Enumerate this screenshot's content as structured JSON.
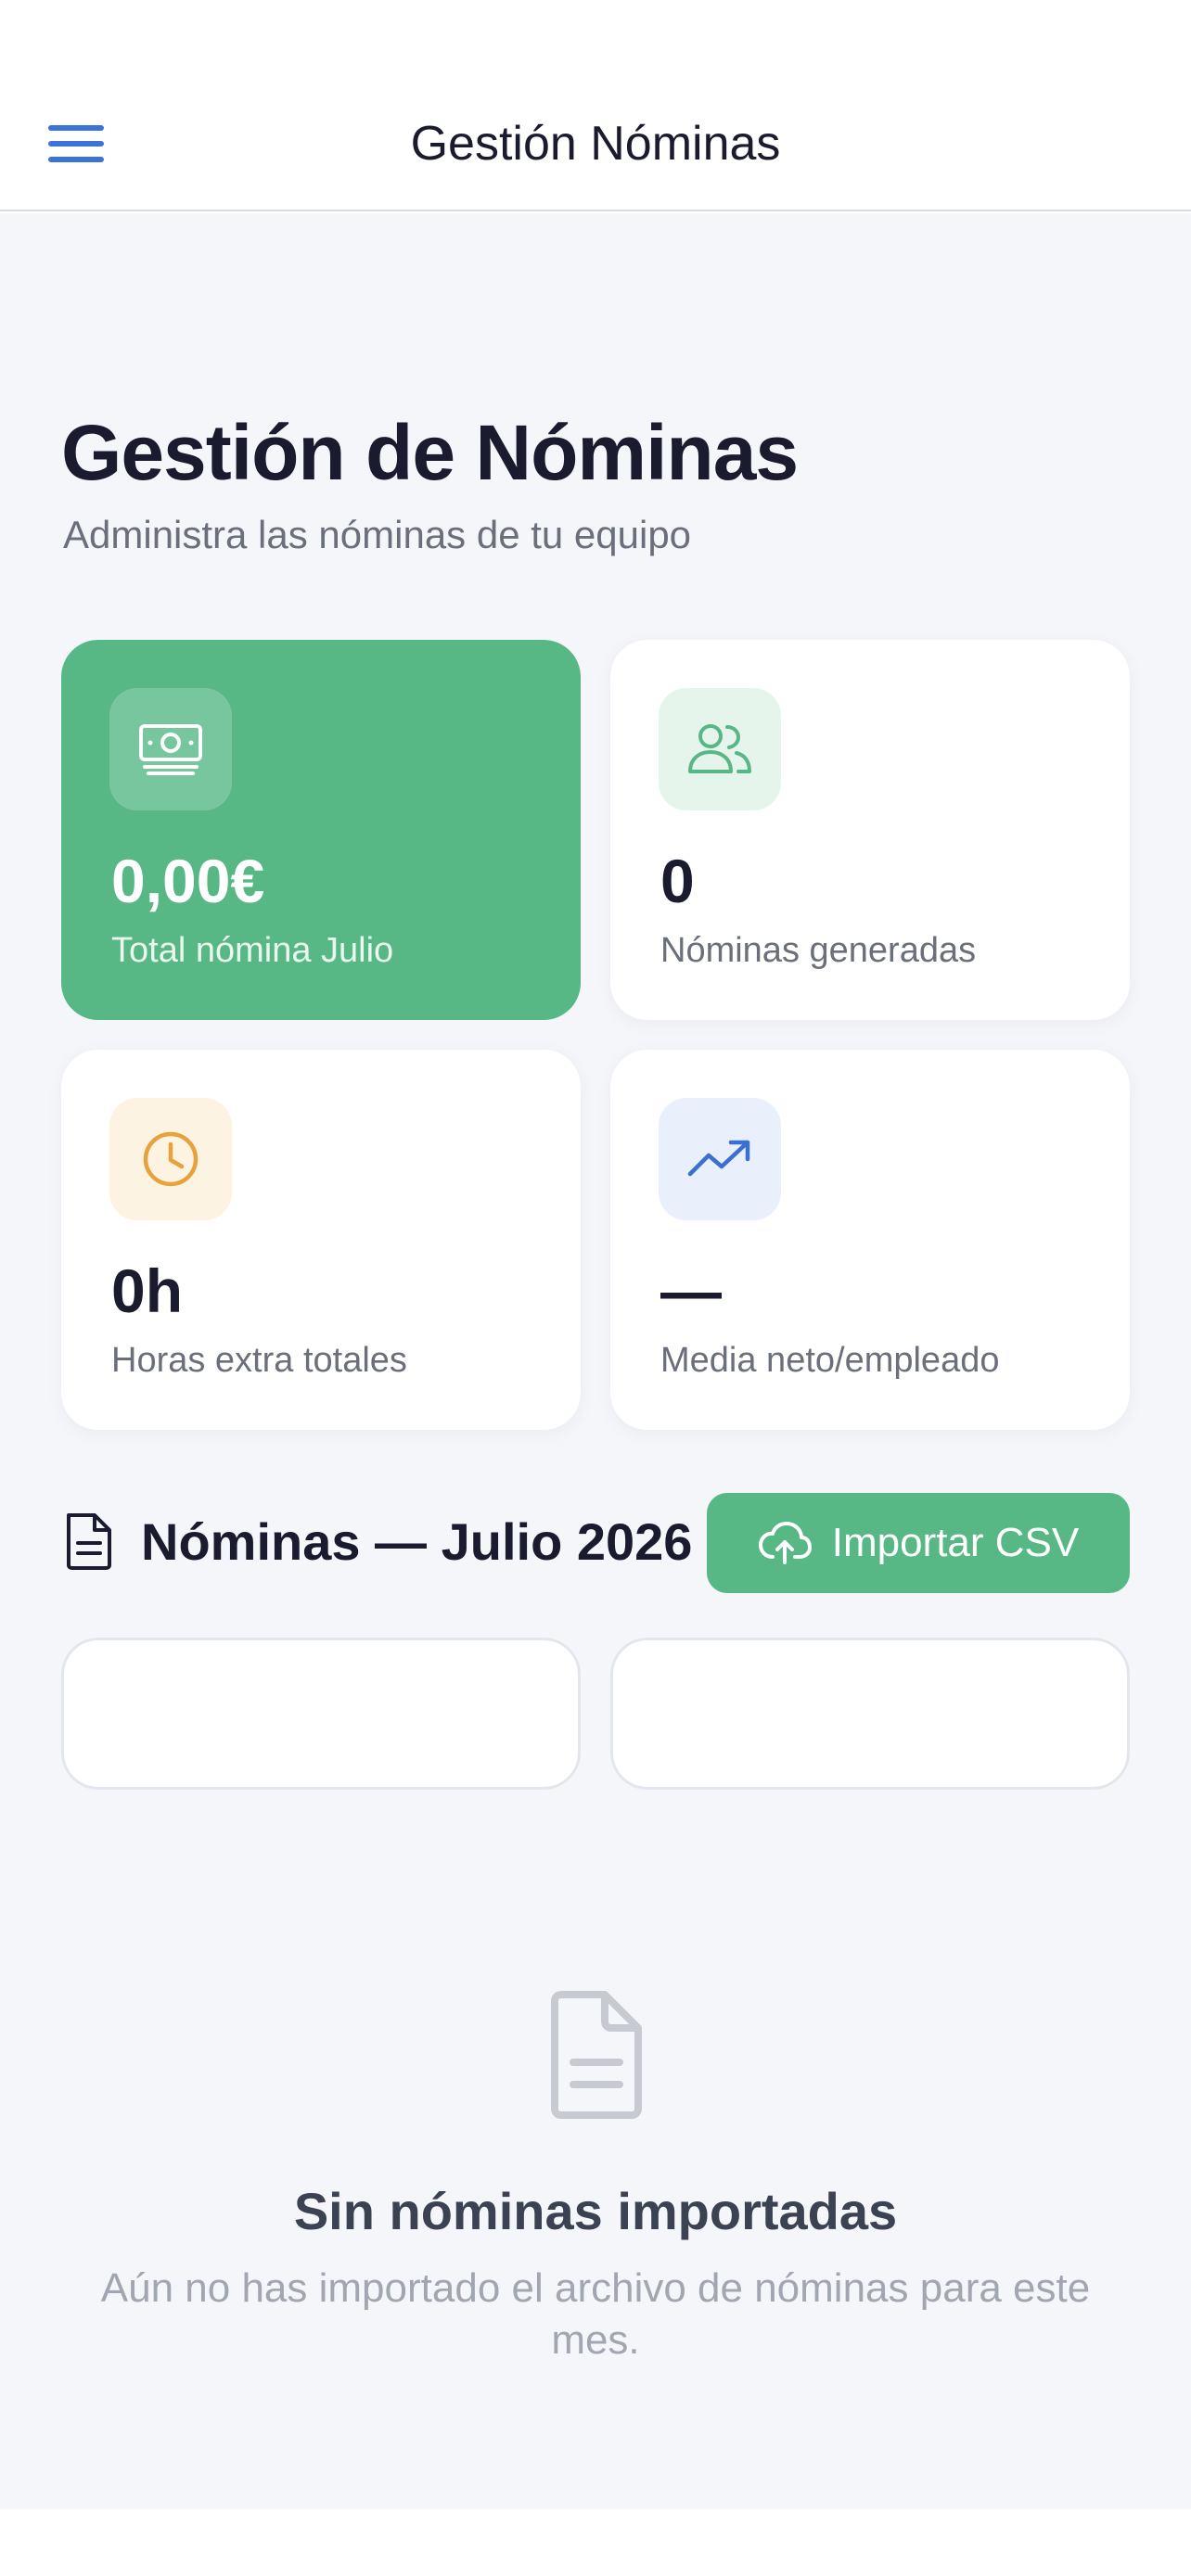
{
  "header": {
    "title": "Gestión Nóminas",
    "menu_icon": "hamburger-menu-icon"
  },
  "page": {
    "title": "Gestión de Nóminas",
    "subtitle": "Administra las nóminas de tu equipo"
  },
  "stats": [
    {
      "icon": "money-icon",
      "value": "0,00€",
      "label": "Total nómina Julio",
      "accent": "#57b885"
    },
    {
      "icon": "users-icon",
      "value": "0",
      "label": "Nóminas generadas",
      "accent": "#57b885"
    },
    {
      "icon": "clock-icon",
      "value": "0h",
      "label": "Horas extra totales",
      "accent": "#e8a23c"
    },
    {
      "icon": "trending-up-icon",
      "value": "—",
      "label": "Media neto/empleado",
      "accent": "#3b6fd4"
    }
  ],
  "section": {
    "icon": "document-icon",
    "title": "Nóminas — Julio 2026",
    "import_label": "Importar CSV",
    "import_icon": "cloud-upload-icon"
  },
  "filters": [
    "",
    ""
  ],
  "empty_state": {
    "icon": "document-icon",
    "title": "Sin nóminas importadas",
    "description": "Aún no has importado el archivo de nóminas para este mes."
  },
  "colors": {
    "brand_green": "#57b885",
    "menu_blue": "#3b74d8",
    "background": "#f5f6fa"
  }
}
